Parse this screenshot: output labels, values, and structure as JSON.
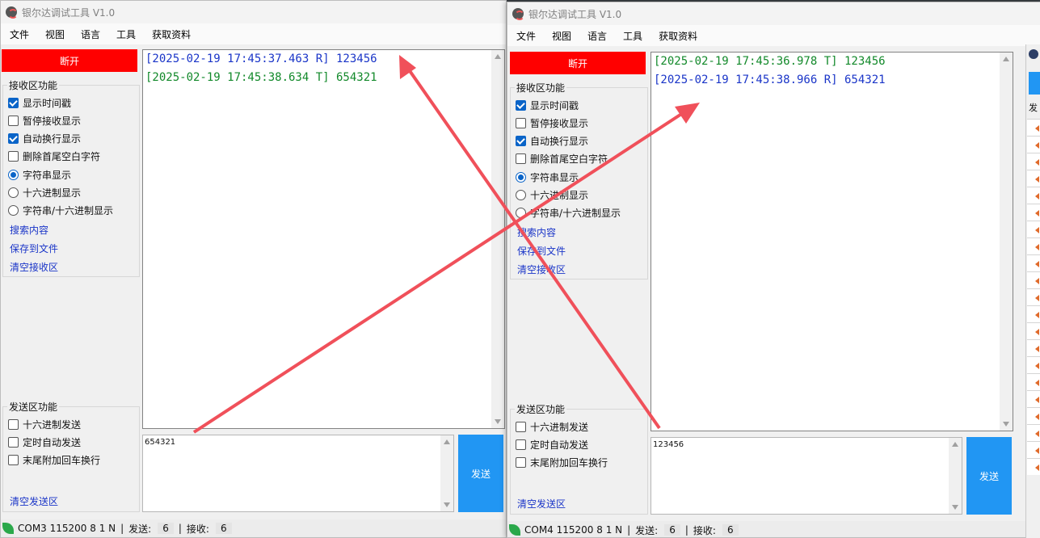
{
  "app_title": "银尔达调试工具 V1.0",
  "menu": [
    "文件",
    "视图",
    "语言",
    "工具",
    "获取资料"
  ],
  "disconnect_label": "断开",
  "receive_group": {
    "title": "接收区功能",
    "show_timestamp": "显示时间戳",
    "pause_receive": "暂停接收显示",
    "auto_wrap": "自动换行显示",
    "trim_whitespace": "删除首尾空白字符",
    "string_display": "字符串显示",
    "hex_display": "十六进制显示",
    "string_hex_display": "字符串/十六进制显示",
    "search": "搜索内容",
    "save_to_file": "保存到文件",
    "clear_receive": "清空接收区"
  },
  "send_group": {
    "title": "发送区功能",
    "hex_send": "十六进制发送",
    "timed_send": "定时自动发送",
    "append_crlf": "末尾附加回车换行",
    "clear_send": "清空发送区"
  },
  "send_button": "发送",
  "left_window": {
    "log": [
      {
        "text": "[2025-02-19 17:45:37.463 R] 123456",
        "color": "#1a35c8"
      },
      {
        "text": "[2025-02-19 17:45:38.634 T] 654321",
        "color": "#12892a"
      }
    ],
    "send_value": "654321",
    "status": {
      "port": "COM3 115200 8 1 N",
      "sent_label": "发送:",
      "sent_value": "6",
      "recv_label": "接收:",
      "recv_value": "6"
    }
  },
  "right_window": {
    "log": [
      {
        "text": "[2025-02-19 17:45:36.978 T] 123456",
        "color": "#12892a"
      },
      {
        "text": "[2025-02-19 17:45:38.966 R] 654321",
        "color": "#1a35c8"
      }
    ],
    "send_value": "123456",
    "status": {
      "port": "COM4 115200 8 1 N",
      "sent_label": "发送:",
      "sent_value": "6",
      "recv_label": "接收:",
      "recv_value": "6"
    }
  },
  "side_strip": {
    "header_char": "发"
  },
  "accent_colors": {
    "disconnect": "#ff0000",
    "send_button": "#2196f3",
    "annotation_arrow": "#f0505a"
  }
}
